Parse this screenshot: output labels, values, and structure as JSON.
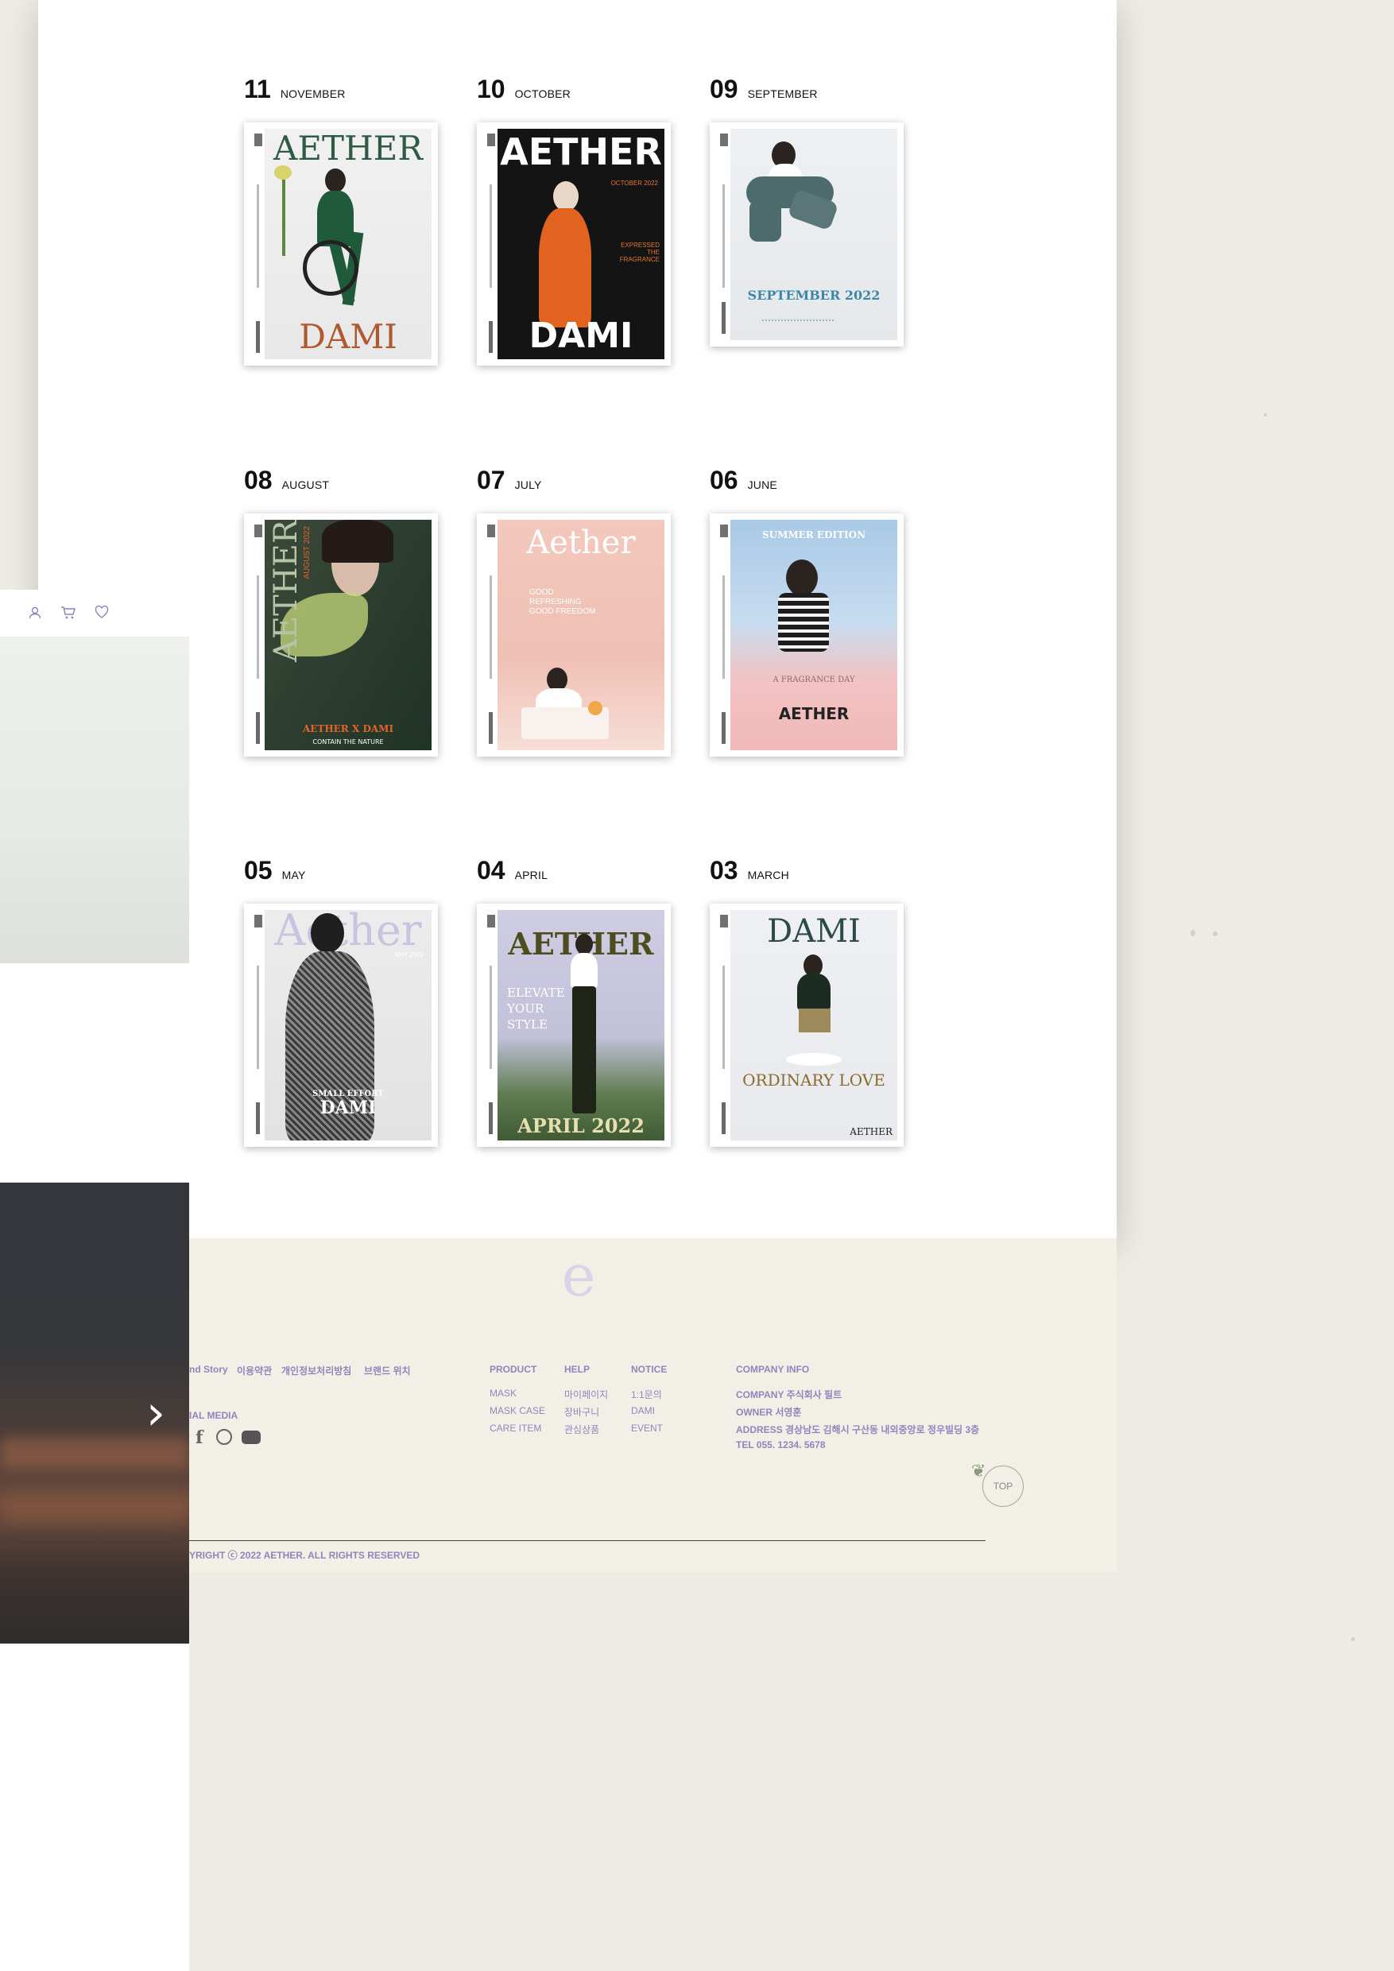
{
  "issues": [
    {
      "num": "11",
      "month": "NOVEMBER",
      "cover": {
        "title": "AETHER",
        "bottom": "DAMI"
      }
    },
    {
      "num": "10",
      "month": "OCTOBER",
      "cover": {
        "title": "AETHER",
        "sub": "OCTOBER 2022",
        "bottom": "DAMI",
        "note": "EXPRESSED THE FRAGRANCE"
      }
    },
    {
      "num": "09",
      "month": "SEPTEMBER",
      "cover": {
        "bottom": "SEPTEMBER 2022"
      }
    },
    {
      "num": "08",
      "month": "AUGUST",
      "cover": {
        "title": "AETHER",
        "sub": "AUGUST 2022",
        "bottom": "AETHER X DAMI",
        "note": "CONTAIN THE NATURE"
      }
    },
    {
      "num": "07",
      "month": "JULY",
      "cover": {
        "title": "Aether",
        "note": "GOOD REFRESHING GOOD FREEDOM"
      }
    },
    {
      "num": "06",
      "month": "JUNE",
      "cover": {
        "title": "SUMMER EDITION",
        "bottom": "AETHER",
        "note": "A FRAGRANCE DAY"
      }
    },
    {
      "num": "05",
      "month": "MAY",
      "cover": {
        "title": "Aether",
        "sub": "MAY 2022",
        "bottom": "DAMI",
        "note": "SMALL EFFORT"
      }
    },
    {
      "num": "04",
      "month": "APRIL",
      "cover": {
        "title": "AETHER",
        "bottom": "APRIL 2022",
        "note": "ELEVATE YOUR STYLE"
      }
    },
    {
      "num": "03",
      "month": "MARCH",
      "cover": {
        "title": "DAMI",
        "bottom": "ORDINARY LOVE",
        "note": "AETHER"
      }
    }
  ],
  "left_panel": {
    "icons": [
      "user-icon",
      "cart-icon",
      "heart-icon"
    ],
    "arrow": "›"
  },
  "footer": {
    "links": [
      "nd Story",
      "이용약관",
      "개인정보처리방침",
      "브랜드 위치"
    ],
    "social_label": "IAL MEDIA",
    "product": {
      "head": "PRODUCT",
      "items": [
        "MASK",
        "MASK CASE",
        "CARE ITEM"
      ]
    },
    "help": {
      "head": "HELP",
      "items": [
        "마이페이지",
        "장바구니",
        "관심상품"
      ]
    },
    "notice": {
      "head": "NOTICE",
      "items": [
        "1:1문의",
        "DAMI",
        "EVENT"
      ]
    },
    "company": {
      "head": "COMPANY INFO",
      "items": [
        "COMPANY 주식회사 필트",
        "OWNER 서영훈",
        "ADDRESS 경상남도 김해시 구산동 내외중앙로 정우빌딩 3층",
        "TEL 055. 1234. 5678"
      ]
    },
    "copyright": "YRIGHT ⓒ 2022 AETHER. ALL RIGHTS RESERVED",
    "top": "TOP"
  },
  "colors": {
    "accent": "#8e86be",
    "footer_bg": "#f2efe6",
    "page_bg": "#eeebe5"
  }
}
